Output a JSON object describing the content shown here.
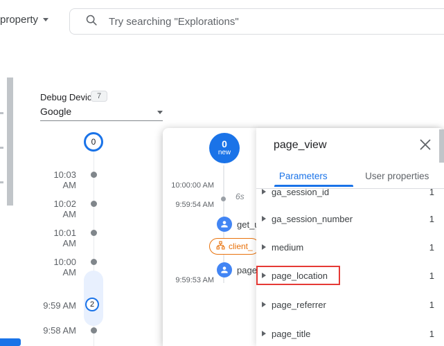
{
  "topbar": {
    "property_label": "property",
    "search": {
      "placeholder": "Try searching \"Explorations\"",
      "icon": "search-icon"
    }
  },
  "left_panel": {
    "debug_device_label": "Debug Device",
    "debug_device_count": "7",
    "device_selected": "Google",
    "top_minute_count": "0",
    "minutes": [
      {
        "time": "10:03 AM"
      },
      {
        "time": "10:02 AM"
      },
      {
        "time": "10:01 AM"
      },
      {
        "time": "10:00 AM"
      },
      {
        "time": "9:59 AM",
        "event_count": "2"
      },
      {
        "time": "9:58 AM"
      }
    ]
  },
  "dialog": {
    "new_events_badge": {
      "count": "0",
      "label": "new"
    },
    "stream": {
      "timestamps": [
        "10:00:00 AM",
        "9:59:54 AM",
        "9:59:53 AM"
      ],
      "gap_duration": "6s",
      "events": [
        {
          "label": "get_us",
          "icon": "user-event-icon"
        },
        {
          "label": "client_",
          "icon": "client-id-icon"
        },
        {
          "label": "page_v",
          "icon": "user-event-icon"
        }
      ]
    },
    "detail": {
      "title": "page_view",
      "tabs": [
        {
          "label": "Parameters",
          "active": true
        },
        {
          "label": "User properties",
          "active": false
        }
      ],
      "parameters": [
        {
          "name": "ga_session_id",
          "value": "1"
        },
        {
          "name": "ga_session_number",
          "value": "1"
        },
        {
          "name": "medium",
          "value": "1"
        },
        {
          "name": "page_location",
          "value": "1",
          "highlighted": true
        },
        {
          "name": "page_referrer",
          "value": "1"
        },
        {
          "name": "page_title",
          "value": "1"
        }
      ]
    }
  },
  "colors": {
    "accent_blue": "#1a73e8",
    "event_icon_blue": "#4285f4",
    "client_orange": "#e8710a",
    "highlight_red": "#e53935",
    "minute_highlight": "#e8f0fe"
  }
}
